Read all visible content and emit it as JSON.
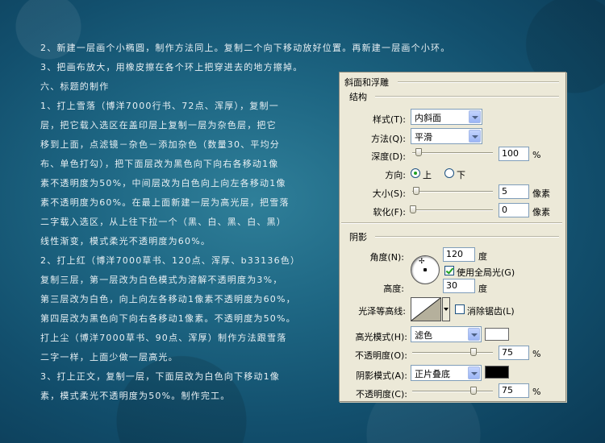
{
  "tutorial": {
    "lines": [
      "2、新建一层画个小椭圆，制作方法同上。复制二个向下移动放好位置。再新建一层画个小环。",
      "3、把画布放大，用橡皮擦在各个环上把穿进去的地方擦掉。",
      "六、标题的制作",
      "1、打上雪落（博洋7000行书、72点、浑厚），复制一",
      "层，把它载入选区在盖印层上复制一层为杂色层，把它",
      "移到上面，点滤镜－杂色－添加杂色（数量30、平均分",
      "布、单色打勾），把下面层改为黑色向下向右各移动1像",
      "素不透明度为50%，中间层改为白色向上向左各移动1像",
      "素不透明度为60%。在最上面新建一层为高光层，把雪落",
      "二字载入选区，从上往下拉一个（黑、白、黑、白、黑）",
      "线性渐变，模式柔光不透明度为60%。",
      "2、打上红（博洋7000草书、120点、浑厚、b33136色）",
      "复制三层，第一层改为白色模式为溶解不透明度为3%，",
      "第三层改为白色，向上向左各移动1像素不透明度为60%，",
      "第四层改为黑色向下向右各移动1像素。不透明度为50%。",
      "打上尘（博洋7000草书、90点、浑厚）制作方法跟雪落",
      "二字一样，上面少做一层高光。",
      "3、打上正文，复制一层，下面层改为白色向下移动1像",
      "素，模式柔光不透明度为50%。制作完工。"
    ]
  },
  "panel": {
    "title": "斜面和浮雕",
    "structure": {
      "heading": "结构",
      "style_label": "样式(T):",
      "style_value": "内斜面",
      "method_label": "方法(Q):",
      "method_value": "平滑",
      "depth_label": "深度(D):",
      "depth_value": "100",
      "depth_unit": "%",
      "direction_label": "方向:",
      "direction_up": "上",
      "direction_down": "下",
      "size_label": "大小(S):",
      "size_value": "5",
      "size_unit": "像素",
      "soften_label": "软化(F):",
      "soften_value": "0",
      "soften_unit": "像素"
    },
    "shading": {
      "heading": "阴影",
      "angle_label": "角度(N):",
      "angle_value": "120",
      "angle_unit": "度",
      "global_light_label": "使用全局光(G)",
      "altitude_label": "高度:",
      "altitude_value": "30",
      "altitude_unit": "度",
      "contour_label": "光泽等高线:",
      "antialias_label": "消除锯齿(L)",
      "highlight_mode_label": "高光模式(H):",
      "highlight_mode_value": "滤色",
      "highlight_color": "#ffffff",
      "highlight_opacity_label": "不透明度(O):",
      "highlight_opacity_value": "75",
      "highlight_opacity_unit": "%",
      "shadow_mode_label": "阴影模式(A):",
      "shadow_mode_value": "正片叠底",
      "shadow_color": "#000000",
      "shadow_opacity_label": "不透明度(C):",
      "shadow_opacity_value": "75",
      "shadow_opacity_unit": "%"
    }
  }
}
